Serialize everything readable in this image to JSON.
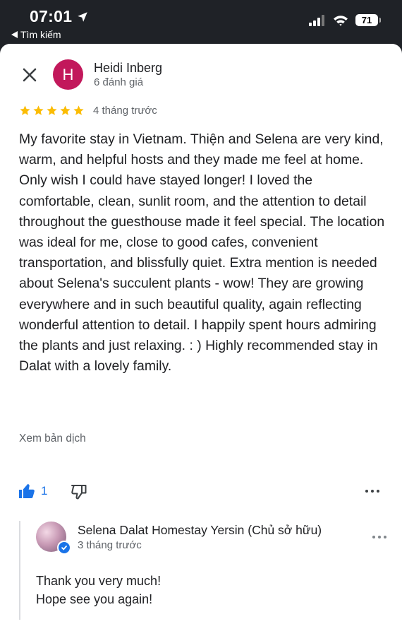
{
  "status_bar": {
    "time": "07:01",
    "back_label": "Tìm kiếm",
    "battery": "71"
  },
  "review": {
    "avatar_letter": "H",
    "reviewer_name": "Heidi Inberg",
    "reviewer_meta": "6 đánh giá",
    "rating": 5,
    "date": "4 tháng trước",
    "text": "My favorite stay in Vietnam. Thiện and Selena are very kind, warm, and helpful hosts and they made me feel at home. Only wish I could have stayed longer! I loved the comfortable, clean, sunlit room, and the attention to detail throughout the guesthouse made it feel special. The location was ideal for me, close to good cafes, convenient transportation, and blissfully quiet. Extra mention is needed about Selena's succulent plants - wow! They are growing everywhere and in such beautiful quality, again reflecting wonderful attention to detail. I happily spent hours admiring the plants and just relaxing. : ) Highly recommended stay in Dalat with a lovely family.",
    "translate_label": "Xem bản dịch",
    "like_count": "1"
  },
  "owner_reply": {
    "name": "Selena Dalat Homestay Yersin (Chủ sở hữu)",
    "date": "3 tháng trước",
    "line1": "Thank you very much!",
    "line2": "Hope see you again!"
  },
  "colors": {
    "accent": "#1a73e8",
    "star": "#fbbc04",
    "avatar": "#c2185b"
  }
}
